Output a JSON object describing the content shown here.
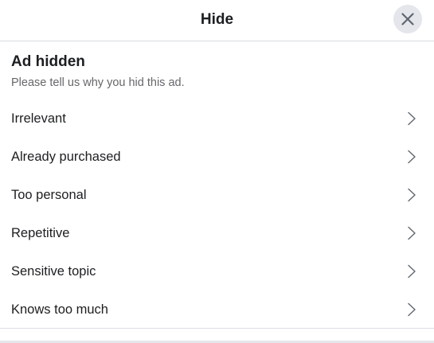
{
  "header": {
    "title": "Hide",
    "close_icon": "close-icon"
  },
  "section": {
    "title": "Ad hidden",
    "subtitle": "Please tell us why you hid this ad."
  },
  "reasons": [
    {
      "label": "Irrelevant",
      "icon": "chevron-right-icon"
    },
    {
      "label": "Already purchased",
      "icon": "chevron-right-icon"
    },
    {
      "label": "Too personal",
      "icon": "chevron-right-icon"
    },
    {
      "label": "Repetitive",
      "icon": "chevron-right-icon"
    },
    {
      "label": "Sensitive topic",
      "icon": "chevron-right-icon"
    },
    {
      "label": "Knows too much",
      "icon": "chevron-right-icon"
    }
  ],
  "colors": {
    "text_primary": "#1c1e21",
    "text_secondary": "#65676b",
    "close_button_bg": "#e4e6eb",
    "divider": "#dadde1",
    "chevron": "#606770"
  }
}
